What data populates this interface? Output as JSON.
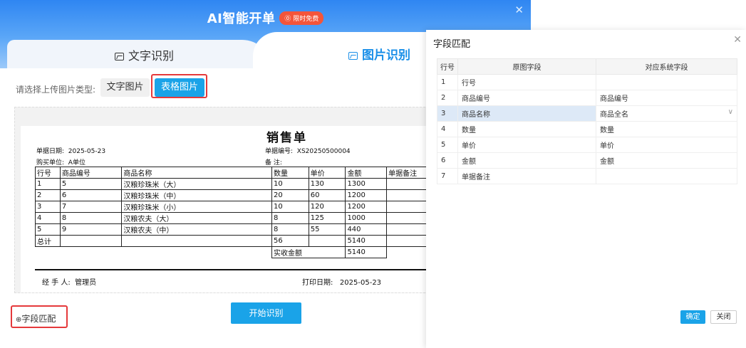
{
  "header": {
    "title": "AI智能开单",
    "badge": "限时免费"
  },
  "tabs": [
    {
      "label": "文字识别"
    },
    {
      "label": "图片识别"
    }
  ],
  "upload_type": {
    "label": "请选择上传图片类型:",
    "options": [
      "文字图片",
      "表格图片"
    ],
    "selected": "表格图片"
  },
  "document": {
    "title": "销售单",
    "date_label": "单据日期:",
    "date": "2025-05-23",
    "number_label": "单据编号:",
    "number": "XS20250500004",
    "buyer_label": "购买单位:",
    "buyer": "A单位",
    "note_label": "备    注:",
    "columns": [
      "行号",
      "商品编号",
      "商品名称",
      "数量",
      "单价",
      "金额",
      "单据备注"
    ],
    "rows": [
      [
        "1",
        "5",
        "汉粮珍珠米（大）",
        "10",
        "130",
        "1300",
        ""
      ],
      [
        "2",
        "6",
        "汉粮珍珠米（中）",
        "20",
        "60",
        "1200",
        ""
      ],
      [
        "3",
        "7",
        "汉粮珍珠米（小）",
        "10",
        "120",
        "1200",
        ""
      ],
      [
        "4",
        "8",
        "汉粮农夫（大）",
        "8",
        "125",
        "1000",
        ""
      ],
      [
        "5",
        "9",
        "汉粮农夫（中）",
        "8",
        "55",
        "440",
        ""
      ]
    ],
    "total_label": "总计",
    "total_qty": "56",
    "total_amount": "5140",
    "paid_label": "实收金额",
    "paid_amount": "5140",
    "handler_label": "经 手 人:",
    "handler": "管理员",
    "print_label": "打印日期:",
    "print_date": "2025-05-23"
  },
  "field_match_label": "字段匹配",
  "start_button": "开始识别",
  "side_dialog": {
    "title": "字段匹配",
    "columns": [
      "行号",
      "原图字段",
      "对应系统字段"
    ],
    "rows": [
      {
        "no": "1",
        "source": "行号",
        "system": ""
      },
      {
        "no": "2",
        "source": "商品编号",
        "system": "商品编号"
      },
      {
        "no": "3",
        "source": "商品名称",
        "system": "商品全名"
      },
      {
        "no": "4",
        "source": "数量",
        "system": "数量"
      },
      {
        "no": "5",
        "source": "单价",
        "system": "单价"
      },
      {
        "no": "6",
        "source": "金额",
        "system": "金额"
      },
      {
        "no": "7",
        "source": "单据备注",
        "system": ""
      }
    ],
    "ok_button": "确定",
    "cancel_button": "关闭"
  },
  "colors": {
    "accent": "#1aa3e8",
    "highlight": "#e5393b",
    "badge": "#f4553a"
  }
}
